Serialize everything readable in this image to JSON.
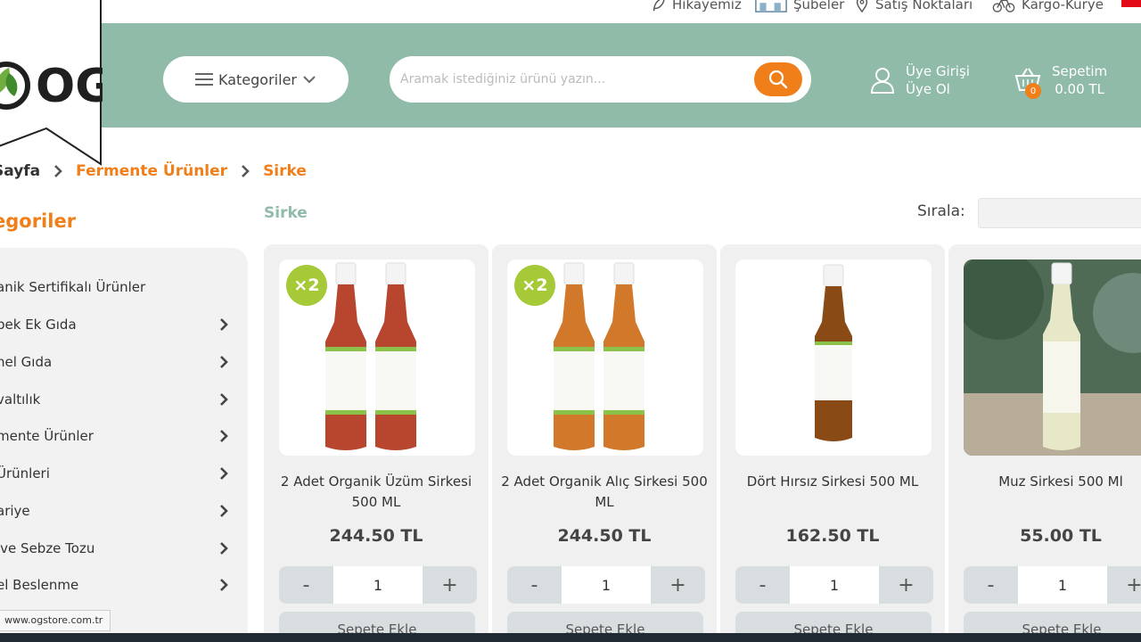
{
  "topbar": {
    "links": [
      {
        "label": "Hikayemiz",
        "icon": "leaf-icon"
      },
      {
        "label": "Şubeler",
        "icon": "store-icon"
      },
      {
        "label": "Satış Noktaları",
        "icon": "location-pin-icon"
      },
      {
        "label": "Kargo-Kurye",
        "icon": "bicycle-icon"
      }
    ]
  },
  "header": {
    "logo_text": "OG",
    "categories_label": "Kategoriler",
    "search_placeholder": "Aramak istediğiniz ürünü yazın...",
    "user_login": "Üye Girişi",
    "user_register": "Üye Ol",
    "cart_label": "Sepetim",
    "cart_total": "0.00 TL",
    "cart_count": "0",
    "accent_color": "#f07f1a",
    "brand_color": "#8fbba8"
  },
  "breadcrumb": [
    "Sayfa",
    "Fermente Ürünler",
    "Sirke"
  ],
  "sidebar": {
    "title": "egoriler",
    "items": [
      {
        "label": "anik Sertifikalı Ürünler",
        "has_arrow": false
      },
      {
        "label": "pek Ek Gıda",
        "has_arrow": true
      },
      {
        "label": "hel Gıda",
        "has_arrow": true
      },
      {
        "label": "valtılık",
        "has_arrow": true
      },
      {
        "label": "mente Ürünler",
        "has_arrow": true
      },
      {
        "label": "Ürünleri",
        "has_arrow": true
      },
      {
        "label": "ariye",
        "has_arrow": true
      },
      {
        "label": "ıve Sebze Tozu",
        "has_arrow": true
      },
      {
        "label": "el Beslenme",
        "has_arrow": true
      }
    ]
  },
  "main": {
    "category_title": "Sirke",
    "sort_label": "Sırala:",
    "products": [
      {
        "name": "2 Adet Organik Üzüm Sirkesi 500 ML",
        "price": "244.50 TL",
        "badge": "×2",
        "qty": "1",
        "add_label": "Sepete Ekle",
        "bottle_color": "#b8462f"
      },
      {
        "name": "2 Adet Organik Alıç Sirkesi 500 ML",
        "price": "244.50 TL",
        "badge": "×2",
        "qty": "1",
        "add_label": "Sepete Ekle",
        "bottle_color": "#d2782a"
      },
      {
        "name": "Dört Hırsız Sirkesi 500 ML",
        "price": "162.50 TL",
        "badge": "",
        "qty": "1",
        "add_label": "Sepete Ekle",
        "bottle_color": "#8a4a16"
      },
      {
        "name": "Muz Sirkesi 500 Ml",
        "price": "55.00 TL",
        "badge": "",
        "qty": "1",
        "add_label": "Sepete Ekle",
        "bottle_color": "#e6e8c8"
      }
    ],
    "minus_label": "-",
    "plus_label": "+"
  },
  "status_url": "www.ogstore.com.tr"
}
